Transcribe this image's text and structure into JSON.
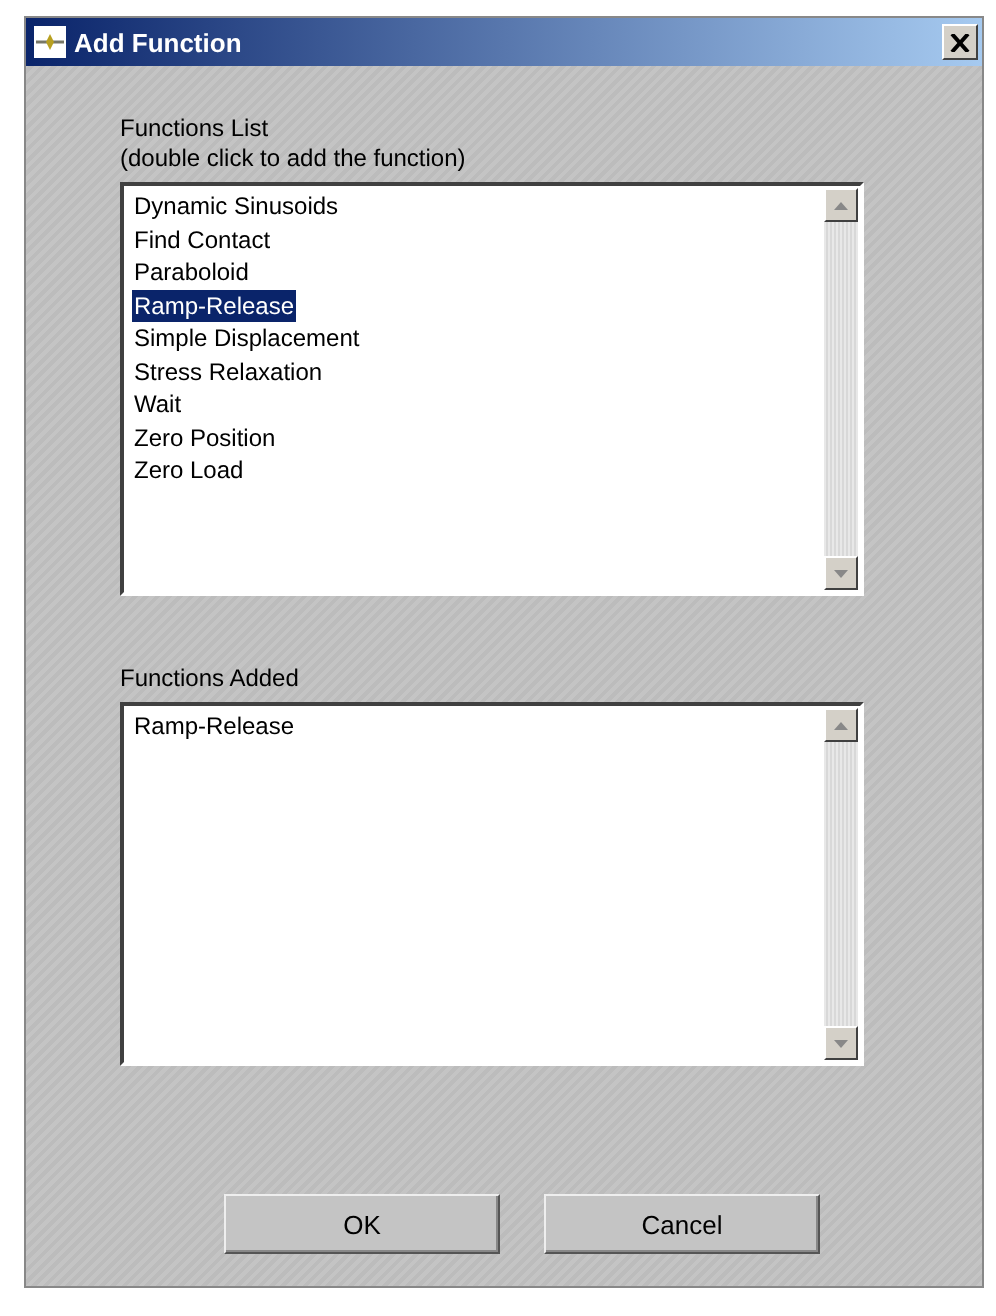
{
  "window": {
    "title": "Add Function"
  },
  "functions_list": {
    "label": "Functions List",
    "hint": "(double click to add the function)",
    "items": [
      {
        "label": "Dynamic Sinusoids",
        "selected": false
      },
      {
        "label": "Find Contact",
        "selected": false
      },
      {
        "label": "Paraboloid",
        "selected": false
      },
      {
        "label": "Ramp-Release",
        "selected": true
      },
      {
        "label": "Simple Displacement",
        "selected": false
      },
      {
        "label": "Stress Relaxation",
        "selected": false
      },
      {
        "label": "Wait",
        "selected": false
      },
      {
        "label": "Zero Position",
        "selected": false
      },
      {
        "label": "Zero Load",
        "selected": false
      }
    ]
  },
  "functions_added": {
    "label": "Functions Added",
    "items": [
      {
        "label": "Ramp-Release",
        "selected": false
      }
    ]
  },
  "buttons": [
    "OK",
    "Cancel"
  ]
}
